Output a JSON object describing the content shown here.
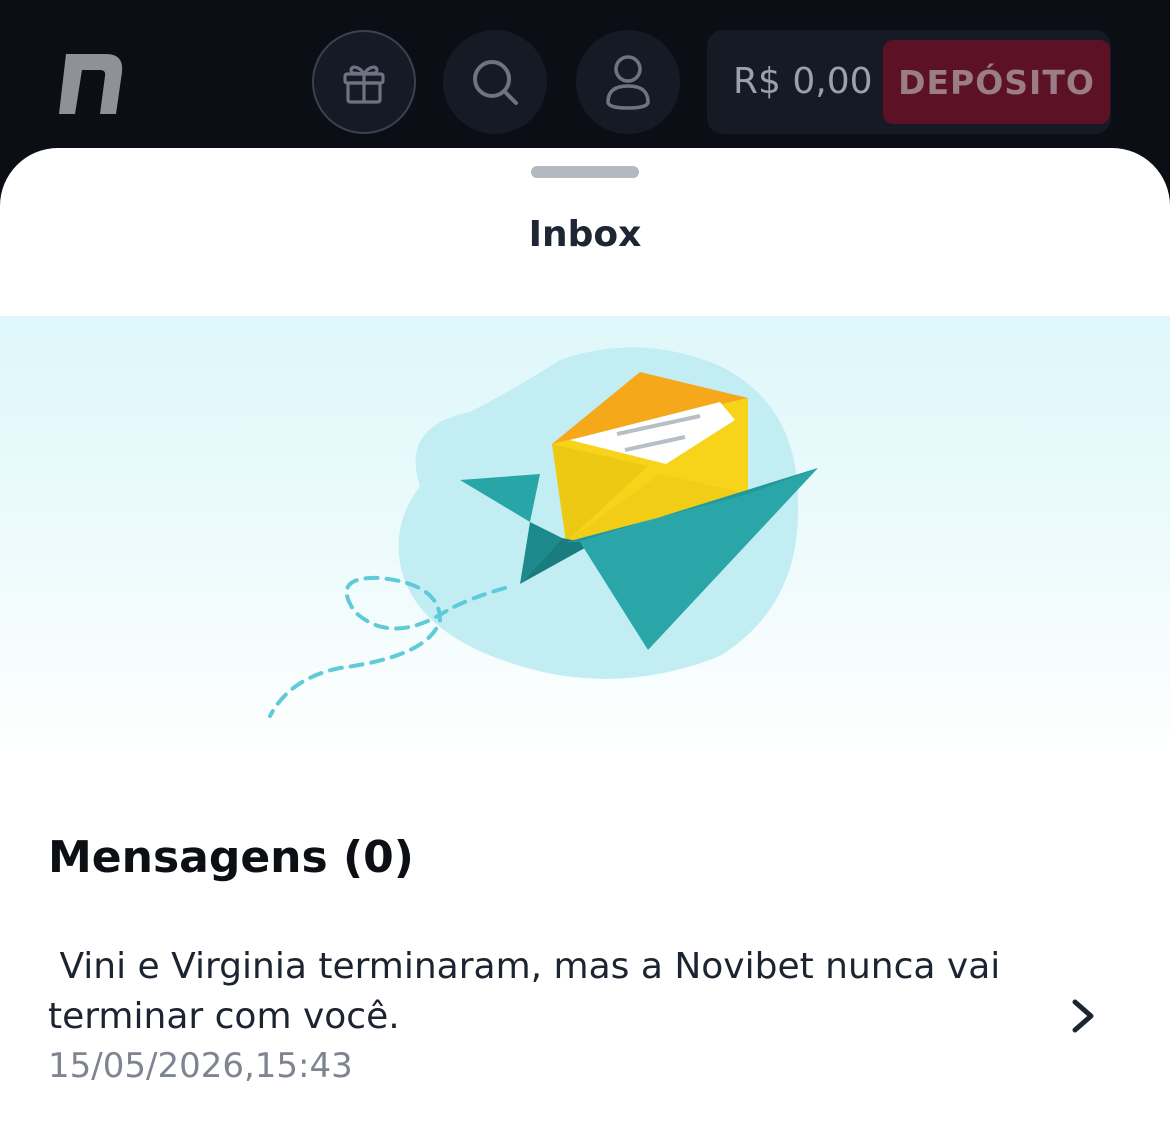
{
  "header": {
    "balance": "R$ 0,00",
    "deposit_label": "DEPÓSITO",
    "icons": [
      "novibet-logo",
      "gift-icon",
      "search-icon",
      "user-icon"
    ]
  },
  "sheet": {
    "title": "Inbox"
  },
  "messages": {
    "section_title": "Mensagens (0)",
    "items": [
      {
        "text": " Vini e Virginia terminaram, mas a Novibet nunca vai terminar com você.",
        "date": "15/05/2026,15:43"
      }
    ]
  },
  "colors": {
    "background_dark": "#0b0e14",
    "deposit": "#5c1224",
    "plane": "#2aa6a8",
    "envelope": "#f7d31a",
    "envelope_flap": "#f6a81b"
  }
}
